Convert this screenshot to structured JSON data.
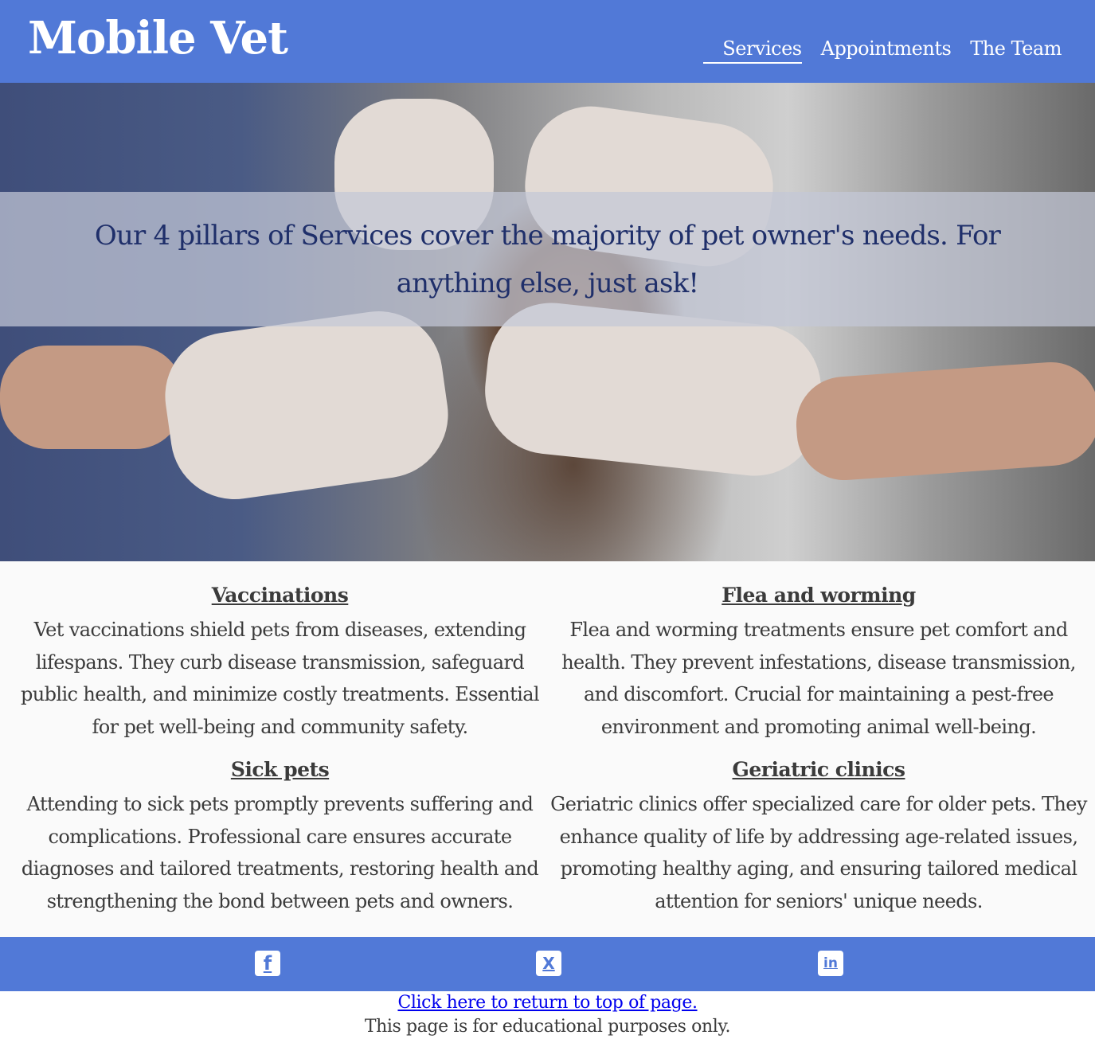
{
  "header": {
    "brand": "Mobile Vet",
    "nav": [
      {
        "label": "Services",
        "active": true
      },
      {
        "label": "Appointments",
        "active": false
      },
      {
        "label": "The Team",
        "active": false
      }
    ]
  },
  "hero": {
    "text": "Our 4 pillars of Services cover the majority of pet owner's needs. For anything else, just ask!"
  },
  "services": [
    {
      "title": "Vaccinations",
      "body": "Vet vaccinations shield pets from diseases, extending lifespans. They curb disease transmission, safeguard public health, and minimize costly treatments. Essential for pet well-being and community safety."
    },
    {
      "title": "Flea and worming",
      "body": "Flea and worming treatments ensure pet comfort and health. They prevent infestations, disease transmission, and discomfort. Crucial for maintaining a pest-free environment and promoting animal well-being."
    },
    {
      "title": "Sick pets",
      "body": "Attending to sick pets promptly prevents suffering and complications. Professional care ensures accurate diagnoses and tailored treatments, restoring health and strengthening the bond between pets and owners."
    },
    {
      "title": "Geriatric clinics",
      "body": "Geriatric clinics offer specialized care for older pets. They enhance quality of life by addressing age-related issues, promoting healthy aging, and ensuring tailored medical attention for seniors' unique needs."
    }
  ],
  "social": {
    "icons": [
      "facebook-icon",
      "x-twitter-icon",
      "linkedin-icon"
    ],
    "glyphs": {
      "facebook": "f",
      "x": "X",
      "linkedin": "in"
    }
  },
  "footer": {
    "top_link": "Click here to return to top of page.",
    "note": "This page is for educational purposes only."
  },
  "colors": {
    "header_bg": "#5179d7",
    "hero_text": "#1f2f6a",
    "body_text": "#3b3b3b",
    "link": "#0000ee"
  }
}
